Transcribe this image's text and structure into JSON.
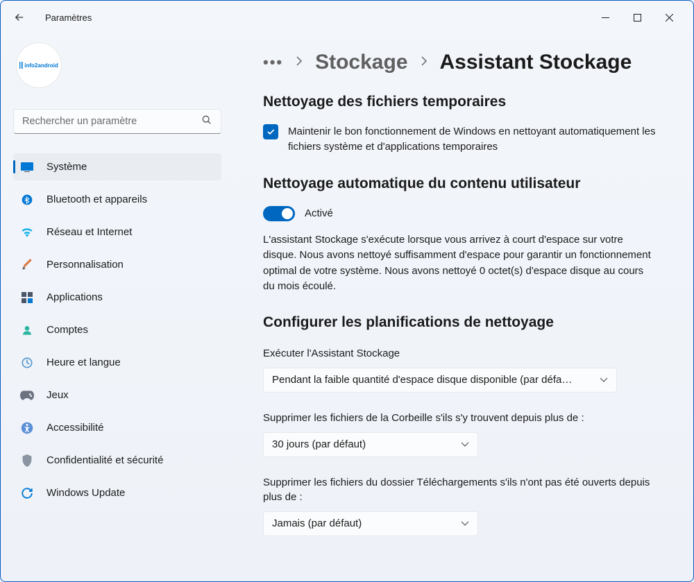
{
  "window": {
    "title": "Paramètres"
  },
  "search": {
    "placeholder": "Rechercher un paramètre"
  },
  "avatar": {
    "logo_text": "info2android"
  },
  "nav": {
    "items": [
      {
        "label": "Système"
      },
      {
        "label": "Bluetooth et appareils"
      },
      {
        "label": "Réseau et Internet"
      },
      {
        "label": "Personnalisation"
      },
      {
        "label": "Applications"
      },
      {
        "label": "Comptes"
      },
      {
        "label": "Heure et langue"
      },
      {
        "label": "Jeux"
      },
      {
        "label": "Accessibilité"
      },
      {
        "label": "Confidentialité et sécurité"
      },
      {
        "label": "Windows Update"
      }
    ]
  },
  "breadcrumb": {
    "parent": "Stockage",
    "current": "Assistant Stockage"
  },
  "sections": {
    "temp_cleanup": {
      "heading": "Nettoyage des fichiers temporaires",
      "checkbox_label": "Maintenir le bon fonctionnement de Windows en nettoyant automatiquement les fichiers système et d'applications temporaires",
      "checked": true
    },
    "auto_cleanup": {
      "heading": "Nettoyage automatique du contenu utilisateur",
      "toggle_state": "Activé",
      "toggle_on": true,
      "description": "L'assistant Stockage s'exécute lorsque vous arrivez à court d'espace sur votre disque. Nous avons nettoyé suffisamment d'espace pour garantir un fonctionnement optimal de votre système. Nous avons nettoyé 0 octet(s) d'espace disque au cours du mois écoulé."
    },
    "schedules": {
      "heading": "Configurer les planifications de nettoyage",
      "run_label": "Exécuter l'Assistant Stockage",
      "run_value": "Pendant la faible quantité d'espace disque disponible (par défa…",
      "recycle_label": "Supprimer les fichiers de la Corbeille s'ils s'y trouvent depuis plus de :",
      "recycle_value": "30 jours (par défaut)",
      "downloads_label": "Supprimer les fichiers du dossier Téléchargements s'ils n'ont pas été ouverts depuis plus de :",
      "downloads_value": "Jamais (par défaut)"
    }
  }
}
